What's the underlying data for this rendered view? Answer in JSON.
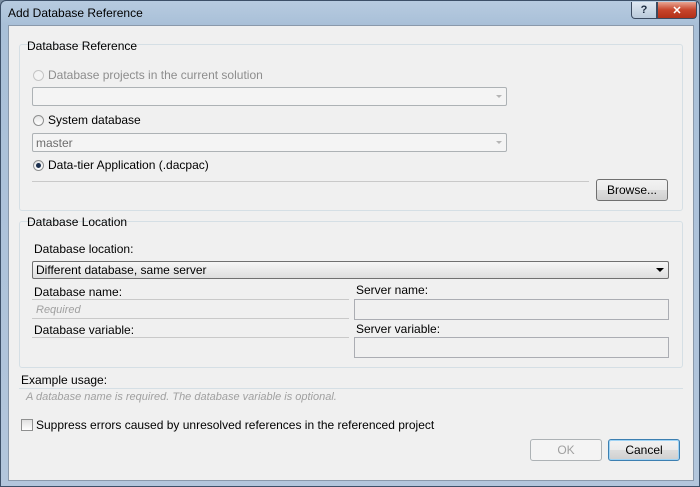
{
  "window": {
    "title": "Add Database Reference",
    "help_glyph": "?",
    "close_glyph": "✕"
  },
  "reference": {
    "group_title": "Database Reference",
    "option_projects": {
      "label": "Database projects in the current solution",
      "selected": false,
      "enabled": false
    },
    "projects_combo": {
      "value": ""
    },
    "option_system": {
      "label": "System database",
      "selected": false,
      "enabled": true
    },
    "system_combo": {
      "value": "master"
    },
    "option_dacpac": {
      "label": "Data-tier Application (.dacpac)",
      "selected": true,
      "enabled": true
    },
    "dacpac_path": {
      "value": ""
    },
    "browse_label": "Browse..."
  },
  "location": {
    "group_title": "Database Location",
    "location_label": "Database location:",
    "location_value": "Different database, same server",
    "db_name_label": "Database name:",
    "db_name_placeholder": "Required",
    "server_name_label": "Server name:",
    "db_variable_label": "Database variable:",
    "server_variable_label": "Server variable:"
  },
  "example": {
    "label": "Example usage:",
    "text": "A database name is required.  The database variable is optional."
  },
  "suppress": {
    "label": "Suppress errors caused by unresolved references in the referenced project",
    "checked": false
  },
  "footer": {
    "ok_label": "OK",
    "cancel_label": "Cancel"
  }
}
